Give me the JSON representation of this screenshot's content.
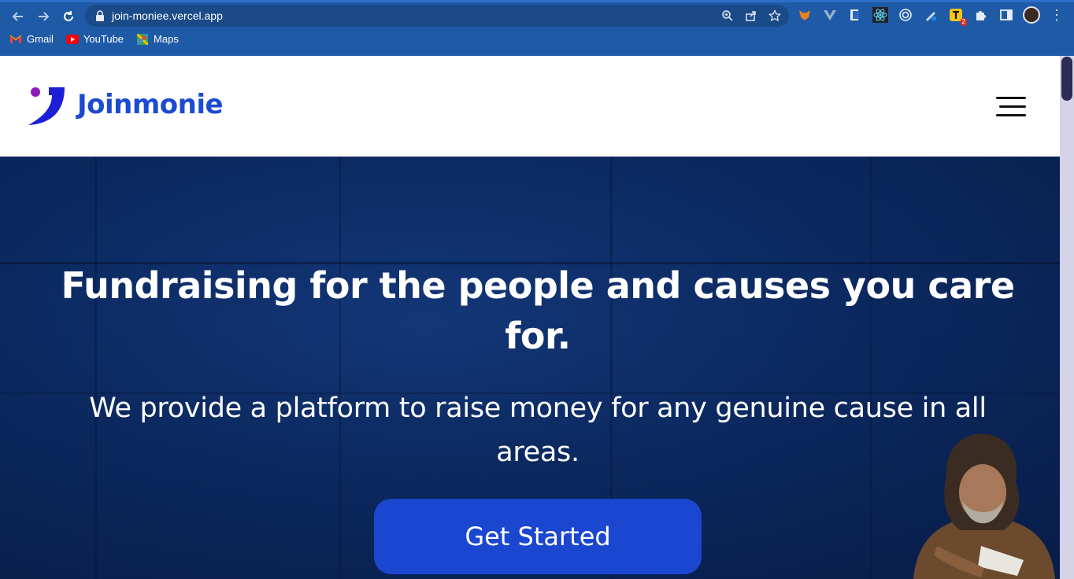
{
  "browser": {
    "url": "join-moniee.vercel.app",
    "bookmarks": [
      {
        "label": "Gmail",
        "icon": "gmail-icon"
      },
      {
        "label": "YouTube",
        "icon": "youtube-icon"
      },
      {
        "label": "Maps",
        "icon": "maps-icon"
      }
    ],
    "extension_badge": "2"
  },
  "header": {
    "brand": "Joinmonie",
    "menu_icon": "hamburger-menu-icon"
  },
  "hero": {
    "title": "Fundraising for the people and causes you care for.",
    "subtitle": "We provide a platform to raise money for any genuine cause in all areas.",
    "cta_label": "Get Started"
  },
  "colors": {
    "brand_blue": "#1c4bd1",
    "brand_dot": "#8e1bb8",
    "cta": "#1b46cf",
    "chrome": "#1f5aa6"
  }
}
